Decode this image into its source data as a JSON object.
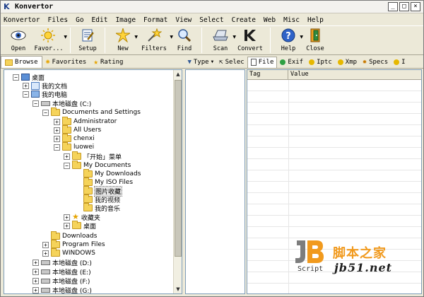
{
  "window": {
    "title": "Konvertor",
    "buttons": [
      "_",
      "□",
      "×"
    ]
  },
  "menu": [
    "Konvertor",
    "Files",
    "Go",
    "Edit",
    "Image",
    "Format",
    "View",
    "Select",
    "Create",
    "Web",
    "Misc",
    "Help"
  ],
  "toolbar": {
    "open": "Open",
    "favorites": "Favor...",
    "setup": "Setup",
    "new": "New",
    "filters": "Filters",
    "find": "Find",
    "scan": "Scan",
    "convert": "Convert",
    "help": "Help",
    "close": "Close"
  },
  "left_tabs": {
    "browse": "Browse",
    "favorites": "Favorites",
    "rating": "Rating"
  },
  "right_tabs": {
    "type": "Type",
    "select": "Selec",
    "file": "File",
    "exif": "Exif",
    "iptc": "Iptc",
    "xmp": "Xmp",
    "specs": "Specs",
    "more": "I"
  },
  "tree": {
    "desktop": "桌面",
    "my_docs": "我的文档",
    "my_computer": "我的电脑",
    "drive_c": "本地磁盘 (C:)",
    "docs_settings": "Documents and Settings",
    "administrator": "Administrator",
    "all_users": "All Users",
    "chenxi": "chenxi",
    "luowei": "luowei",
    "start_menu": "「开始」菜单",
    "my_documents": "My Documents",
    "my_downloads": "My Downloads",
    "my_iso": "My ISO Files",
    "pic_fav": "图片收藏",
    "my_video": "我的视频",
    "my_music": "我的音乐",
    "favorites": "收藏夹",
    "desktop2": "桌面",
    "downloads": "Downloads",
    "program_files": "Program Files",
    "windows": "WINDOWS",
    "drive_d": "本地磁盘 (D:)",
    "drive_e": "本地磁盘 (E:)",
    "drive_f": "本地磁盘 (F:)",
    "drive_g": "本地磁盘 (G:)"
  },
  "props": {
    "tag_header": "Tag",
    "value_header": "Value"
  },
  "watermark": {
    "logo": "JB",
    "script": "Script",
    "cn": "脚本之家",
    "url": "jb51.net"
  }
}
